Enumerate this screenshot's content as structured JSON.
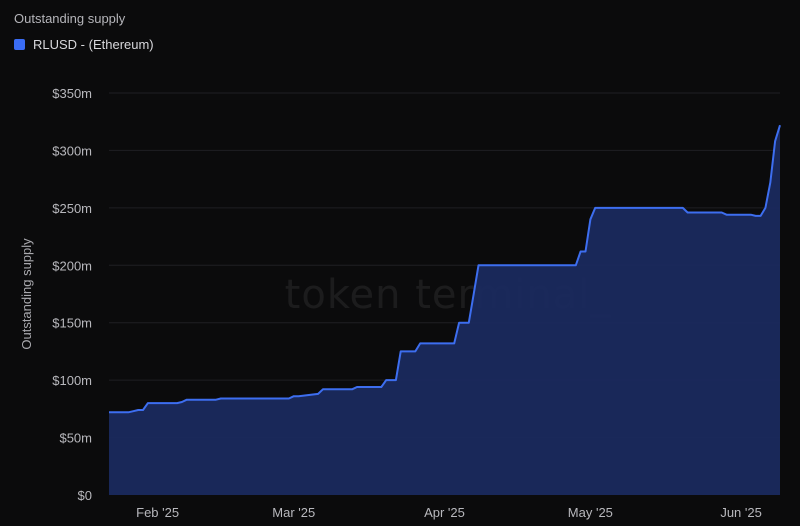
{
  "chart_data": {
    "type": "area",
    "title": "Outstanding supply",
    "ylabel": "Outstanding supply",
    "xlabel": "",
    "watermark": "token terminal_",
    "ylim": [
      0,
      350
    ],
    "yticks": [
      0,
      50,
      100,
      150,
      200,
      250,
      300,
      350
    ],
    "ytick_labels": [
      "$0",
      "$50m",
      "$100m",
      "$150m",
      "$200m",
      "$250m",
      "$300m",
      "$350m"
    ],
    "xlim": [
      "2025-01-22",
      "2025-06-09"
    ],
    "xticks": [
      "2025-02-01",
      "2025-03-01",
      "2025-04-01",
      "2025-05-01",
      "2025-06-01"
    ],
    "xtick_labels": [
      "Feb '25",
      "Mar '25",
      "Apr '25",
      "May '25",
      "Jun '25"
    ],
    "grid": true,
    "legend_position": "top-left",
    "colors": {
      "line": "#3d6ef0",
      "fill": "#1a2a5e",
      "legend": "#3a6cf4",
      "grid": "#1f1f23"
    },
    "series": [
      {
        "name": "RLUSD - (Ethereum)",
        "x": [
          "2025-01-22",
          "2025-01-26",
          "2025-01-27",
          "2025-01-28",
          "2025-01-29",
          "2025-01-30",
          "2025-02-05",
          "2025-02-06",
          "2025-02-07",
          "2025-02-13",
          "2025-02-14",
          "2025-02-15",
          "2025-02-28",
          "2025-03-01",
          "2025-03-02",
          "2025-03-06",
          "2025-03-07",
          "2025-03-13",
          "2025-03-14",
          "2025-03-19",
          "2025-03-20",
          "2025-03-22",
          "2025-03-23",
          "2025-03-26",
          "2025-03-27",
          "2025-04-03",
          "2025-04-04",
          "2025-04-06",
          "2025-04-07",
          "2025-04-08",
          "2025-04-28",
          "2025-04-29",
          "2025-04-30",
          "2025-05-01",
          "2025-05-02",
          "2025-05-20",
          "2025-05-21",
          "2025-05-28",
          "2025-05-29",
          "2025-06-03",
          "2025-06-04",
          "2025-06-05",
          "2025-06-06",
          "2025-06-07",
          "2025-06-08",
          "2025-06-09"
        ],
        "y": [
          72,
          72,
          73,
          74,
          74,
          80,
          80,
          81,
          83,
          83,
          84,
          84,
          84,
          86,
          86,
          88,
          92,
          92,
          94,
          94,
          100,
          100,
          125,
          125,
          132,
          132,
          150,
          150,
          175,
          200,
          200,
          212,
          212,
          240,
          250,
          250,
          246,
          246,
          244,
          244,
          243,
          243,
          250,
          272,
          308,
          322
        ]
      }
    ]
  }
}
